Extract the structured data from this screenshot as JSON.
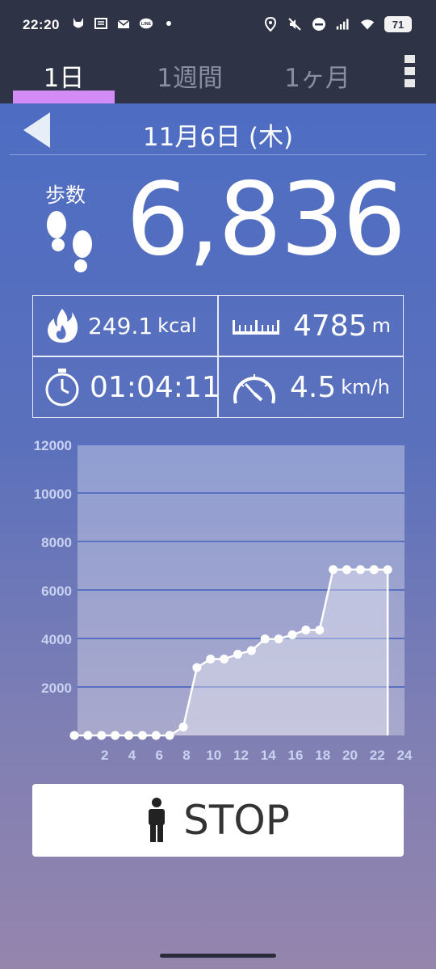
{
  "status_bar": {
    "time": "22:20",
    "battery": "71",
    "left_icons": [
      "fox-icon",
      "news-icon",
      "mail-icon",
      "line-icon",
      "dot-icon"
    ],
    "right_icons": [
      "location-icon",
      "mute-icon",
      "dnd-icon",
      "signal-icon",
      "wifi-icon"
    ]
  },
  "tabs": [
    {
      "label": "1日",
      "active": true
    },
    {
      "label": "1週間",
      "active": false
    },
    {
      "label": "1ヶ月",
      "active": false
    }
  ],
  "date": "11月6日 (木)",
  "steps": {
    "label": "歩数",
    "value": "6,836"
  },
  "stats": {
    "calories": {
      "value": "249.1",
      "unit": "kcal"
    },
    "distance": {
      "value": "4785",
      "unit": "m"
    },
    "duration": {
      "value": "01:04:11"
    },
    "speed": {
      "value": "4.5",
      "unit": "km/h"
    }
  },
  "chart_data": {
    "type": "area",
    "ylim": [
      0,
      12000
    ],
    "yticks": [
      "12000",
      "10000",
      "8000",
      "6000",
      "4000",
      "2000"
    ],
    "xlim": [
      0,
      24
    ],
    "xticks": [
      "2",
      "4",
      "6",
      "8",
      "10",
      "12",
      "14",
      "16",
      "18",
      "20",
      "22",
      "24"
    ],
    "series": [
      {
        "x": [
          0,
          1,
          2,
          3,
          4,
          5,
          6,
          7,
          8,
          9,
          10,
          11,
          12,
          13,
          14,
          15,
          16,
          17,
          18,
          19,
          20,
          21,
          22,
          23
        ],
        "y": [
          0,
          0,
          0,
          0,
          0,
          0,
          0,
          0,
          350,
          2800,
          3150,
          3150,
          3350,
          3500,
          3980,
          3980,
          4150,
          4350,
          4350,
          6840,
          6840,
          6840,
          6840,
          6836
        ]
      }
    ]
  },
  "stop_button": {
    "label": "STOP"
  },
  "colors": {
    "accent": "#d38cf5",
    "header_bg": "#2e3345"
  }
}
